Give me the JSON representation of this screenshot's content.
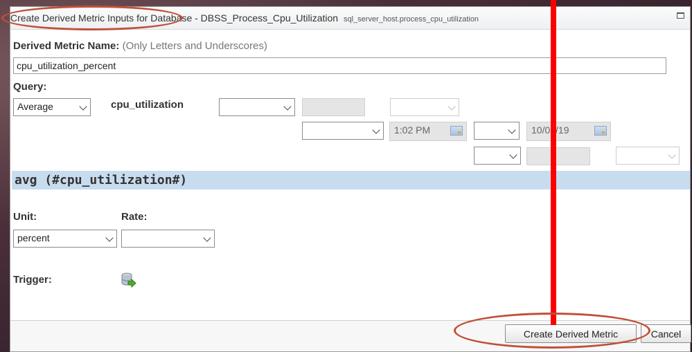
{
  "dialog": {
    "title": "Create Derived Metric Inputs for Database - DBSS_Process_Cpu_Utilization",
    "subtitle": "sql_server_host.process_cpu_utilization"
  },
  "form": {
    "name_label": "Derived Metric Name:",
    "name_hint": "(Only Letters and Underscores)",
    "name_value": "cpu_utilization_percent",
    "query_label": "Query:",
    "aggregate_value": "Average",
    "metric_label": "cpu_utilization",
    "time_value": "1:02 PM",
    "date_value": "10/02/19",
    "expression": "avg (#cpu_utilization#)",
    "unit_label": "Unit:",
    "unit_value": "percent",
    "rate_label": "Rate:",
    "rate_value": "",
    "trigger_label": "Trigger:"
  },
  "buttons": {
    "create": "Create Derived Metric",
    "cancel": "Cancel"
  },
  "colors": {
    "annotation_line": "#ff0000",
    "annotation_ellipse": "#c0503a",
    "expression_bar": "#c8dcf0"
  },
  "icons": {
    "trigger": "database-add-icon",
    "maximize": "maximize-icon",
    "calendar": "calendar-icon"
  }
}
